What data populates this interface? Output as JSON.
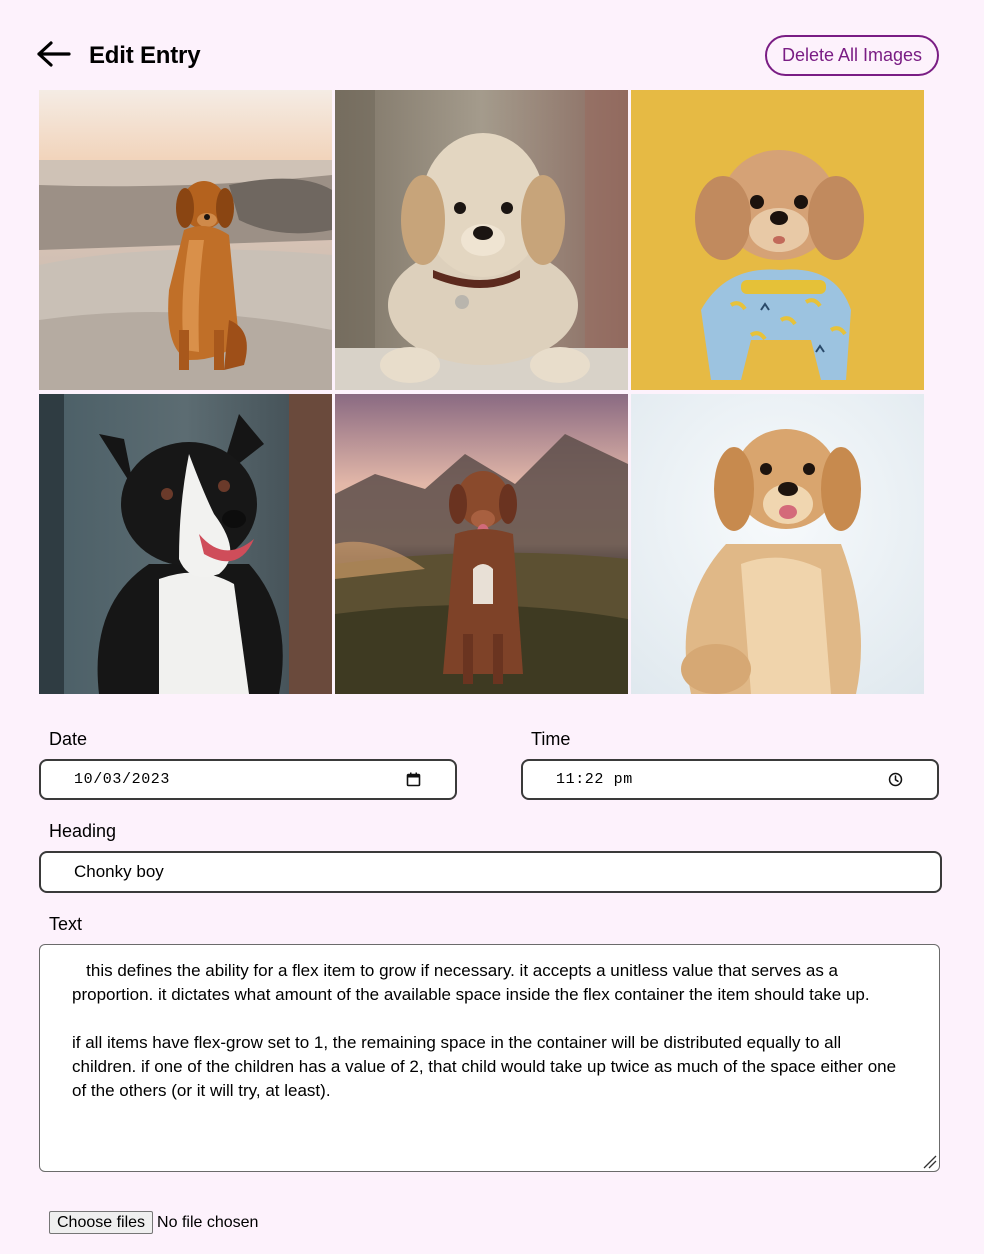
{
  "header": {
    "back_icon": "arrow-left-icon",
    "title": "Edit Entry",
    "delete_label": "Delete All Images",
    "accent_color": "#7a1d84"
  },
  "gallery": {
    "images": [
      {
        "subject": "golden retriever sitting on beach at sunset"
      },
      {
        "subject": "golden retriever puppy lying down with collar"
      },
      {
        "subject": "small fluffy dog in banana-print shirt on yellow background"
      },
      {
        "subject": "black and white border collie smiling"
      },
      {
        "subject": "brown dog sitting in grass field at sunset"
      },
      {
        "subject": "golden dog sitting on white background"
      }
    ]
  },
  "form": {
    "date": {
      "label": "Date",
      "value": "10/03/2023",
      "icon": "calendar-icon"
    },
    "time": {
      "label": "Time",
      "value": "11:22 pm",
      "icon": "clock-icon"
    },
    "heading": {
      "label": "Heading",
      "value": "Chonky boy"
    },
    "text": {
      "label": "Text",
      "value": "   this defines the ability for a flex item to grow if necessary. it accepts a unitless value that serves as a proportion. it dictates what amount of the available space inside the flex container the item should take up.\n\nif all items have flex-grow set to 1, the remaining space in the container will be distributed equally to all children. if one of the children has a value of 2, that child would take up twice as much of the space either one of the others (or it will try, at least)."
    },
    "files": {
      "button_label": "Choose files",
      "status": "No file chosen"
    }
  }
}
